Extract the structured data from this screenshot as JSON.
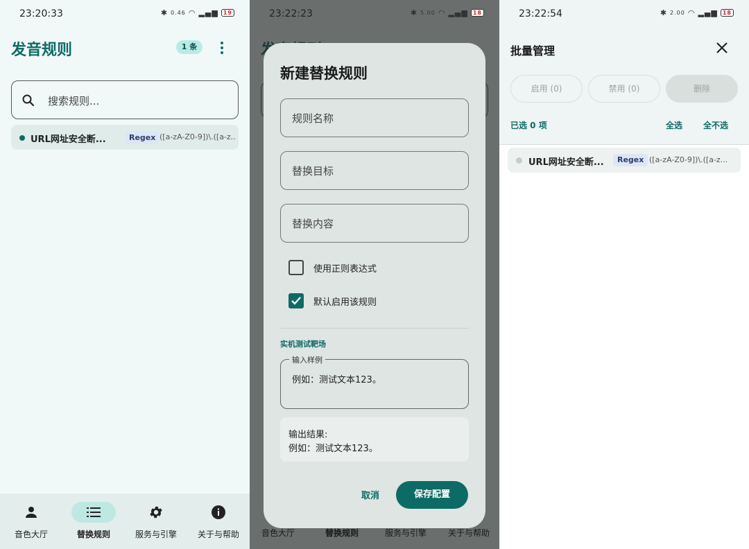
{
  "colors": {
    "accent": "#0d6b65",
    "surface": "#f1f9f8",
    "dialog": "#dfe5e3"
  },
  "screen1": {
    "status": {
      "time": "23:20:33",
      "speed": "0.46",
      "battery": "19"
    },
    "title": "发音规则",
    "count_badge": "1 条",
    "search_placeholder": "搜索规则...",
    "rule": {
      "name": "URL网址安全断...",
      "tag": "Regex",
      "pattern": "([a-zA-Z0-9])\\.([a-z..."
    },
    "nav": [
      {
        "label": "音色大厅",
        "icon": "person-icon"
      },
      {
        "label": "替换规则",
        "icon": "list-icon"
      },
      {
        "label": "服务与引擎",
        "icon": "gear-icon"
      },
      {
        "label": "关于与帮助",
        "icon": "info-icon"
      }
    ]
  },
  "screen2": {
    "status": {
      "time": "23:22:23",
      "speed": "5.00",
      "battery": "18"
    },
    "bg_title": "发音规则",
    "dialog": {
      "title": "新建替换规则",
      "field_name": "规则名称",
      "field_target": "替换目标",
      "field_content": "替换内容",
      "check_regex": "使用正则表达式",
      "check_enable": "默认启用该规则",
      "section_label": "实机测试靶场",
      "sample_legend": "输入样例",
      "sample_value": "例如：测试文本123。",
      "output_label": "输出结果:",
      "output_value": "例如：测试文本123。",
      "cancel": "取消",
      "save": "保存配置"
    },
    "nav": [
      "音色大厅",
      "替换规则",
      "服务与引擎",
      "关于与帮助"
    ]
  },
  "screen3": {
    "status": {
      "time": "23:22:54",
      "speed": "2.00",
      "battery": "18"
    },
    "title": "批量管理",
    "enable_btn": "启用 (0)",
    "disable_btn": "禁用 (0)",
    "delete_btn": "删除",
    "selected_count": "已选 0 项",
    "select_all": "全选",
    "select_none": "全不选",
    "rule": {
      "name": "URL网址安全断...",
      "tag": "Regex",
      "pattern": "([a-zA-Z0-9])\\.([a-z..."
    }
  }
}
